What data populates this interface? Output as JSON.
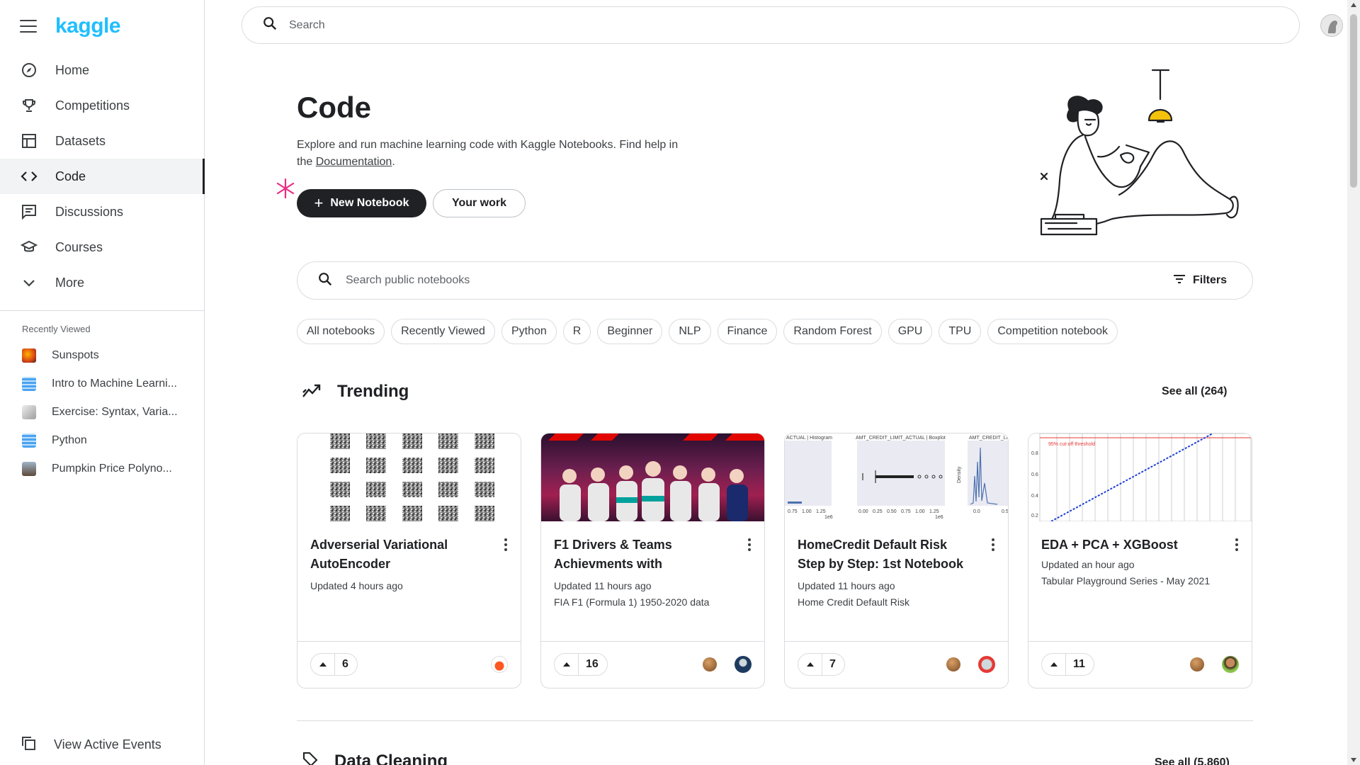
{
  "brand": {
    "logo_text": "kaggle",
    "accent": "#20beff"
  },
  "sidebar": {
    "nav": [
      {
        "label": "Home",
        "icon": "compass-icon"
      },
      {
        "label": "Competitions",
        "icon": "trophy-icon"
      },
      {
        "label": "Datasets",
        "icon": "table-icon"
      },
      {
        "label": "Code",
        "icon": "code-icon",
        "active": true
      },
      {
        "label": "Discussions",
        "icon": "comments-icon"
      },
      {
        "label": "Courses",
        "icon": "school-icon"
      },
      {
        "label": "More",
        "icon": "chevron-down-icon"
      }
    ],
    "recent_title": "Recently Viewed",
    "recent": [
      {
        "label": "Sunspots",
        "color": "#e8651a"
      },
      {
        "label": "Intro to Machine Learni...",
        "color": "#4aa3f0"
      },
      {
        "label": "Exercise: Syntax, Varia...",
        "color": "#9e9e9e"
      },
      {
        "label": "Python",
        "color": "#4aa3f0"
      },
      {
        "label": "Pumpkin Price Polyno...",
        "color": "#7a6a5a"
      }
    ],
    "active_events": "View Active Events"
  },
  "topbar": {
    "search_placeholder": "Search"
  },
  "header": {
    "title": "Code",
    "desc_before": "Explore and run machine learning code with Kaggle Notebooks. Find help in the ",
    "desc_link": "Documentation",
    "desc_after": ".",
    "new_notebook": "New Notebook",
    "your_work": "Your work"
  },
  "notebook_search": {
    "placeholder": "Search public notebooks",
    "filters": "Filters"
  },
  "chips": [
    "All notebooks",
    "Recently Viewed",
    "Python",
    "R",
    "Beginner",
    "NLP",
    "Finance",
    "Random Forest",
    "GPU",
    "TPU",
    "Competition notebook"
  ],
  "trending": {
    "title": "Trending",
    "see_all": "See all (264)",
    "cards": [
      {
        "title": "Adverserial Variational AutoEncoder",
        "updated": "Updated 4 hours ago",
        "source": "",
        "votes": "6"
      },
      {
        "title": "F1 Drivers & Teams Achievments with",
        "updated": "Updated 11 hours ago",
        "source": "FIA F1 (Formula 1) 1950-2020 data",
        "votes": "16"
      },
      {
        "title": "HomeCredit Default Risk Step by Step: 1st Notebook",
        "updated": "Updated 11 hours ago",
        "source": "Home Credit Default Risk",
        "votes": "7"
      },
      {
        "title": "EDA + PCA + XGBoost",
        "updated": "Updated an hour ago",
        "source": "Tabular Playground Series - May 2021",
        "votes": "11"
      }
    ],
    "card3_labels": {
      "a": "ACTUAL | Histogram",
      "b": "AMT_CREDIT_LIMIT_ACTUAL | Boxplot",
      "c": "AMT_CREDIT_LI",
      "ylabel": "Density",
      "xlabel": "1e6"
    },
    "card4_label": "95% cut-off threshold"
  },
  "data_cleaning": {
    "title": "Data Cleaning",
    "see_all": "See all (5,860)"
  }
}
